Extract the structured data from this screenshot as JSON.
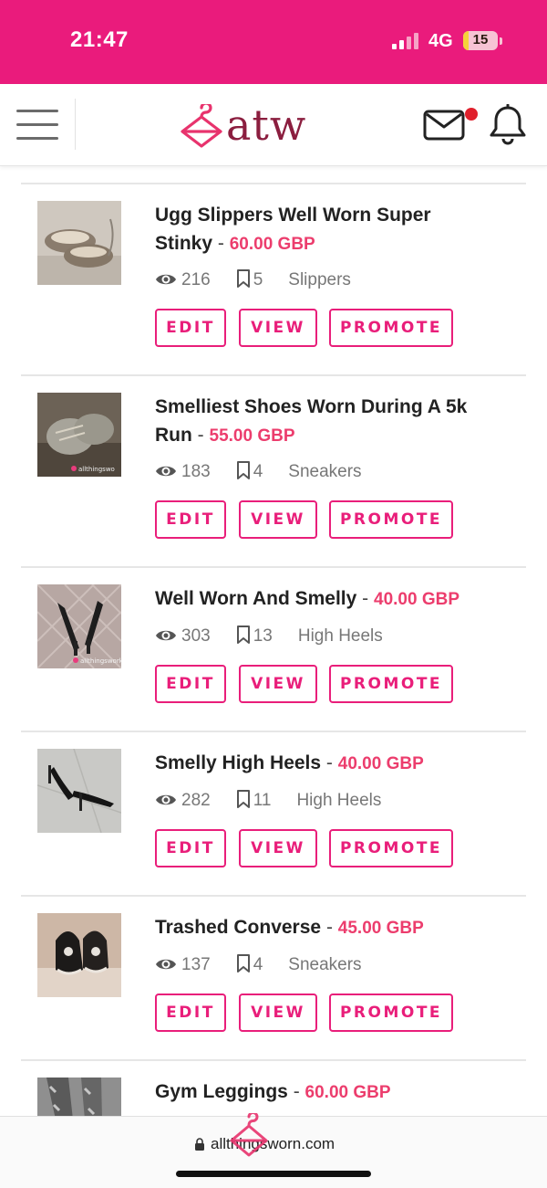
{
  "status_bar": {
    "time": "21:47",
    "network": "4G",
    "battery": "15",
    "battery_level_percent": 15,
    "background": "#ea1b7c"
  },
  "header": {
    "logo_text": "atw",
    "menu_icon": "hamburger-menu-icon",
    "mail_icon": "envelope-icon",
    "bell_icon": "bell-icon",
    "logo_color": "#8b1e3f",
    "accent": "#e91e7a"
  },
  "listings": [
    {
      "title": "Ugg Slippers Well Worn Super Stinky",
      "title_line1": "Ugg Slippers Well Worn Super",
      "title_line2": "Stinky",
      "separator": "-",
      "price": "60.00 GBP",
      "views": "216",
      "saves": "5",
      "category": "Slippers"
    },
    {
      "title": "Smelliest Shoes Worn During A 5k Run",
      "title_line1": "Smelliest Shoes Worn During A 5k",
      "title_line2": "Run",
      "separator": "-",
      "price": "55.00 GBP",
      "views": "183",
      "saves": "4",
      "category": "Sneakers"
    },
    {
      "title": "Well Worn And Smelly",
      "separator": "-",
      "price": "40.00 GBP",
      "views": "303",
      "saves": "13",
      "category": "High Heels"
    },
    {
      "title": "Smelly High Heels",
      "separator": "-",
      "price": "40.00 GBP",
      "views": "282",
      "saves": "11",
      "category": "High Heels"
    },
    {
      "title": "Trashed Converse",
      "separator": "-",
      "price": "45.00 GBP",
      "views": "137",
      "saves": "4",
      "category": "Sneakers"
    },
    {
      "title": "Gym Leggings",
      "separator": "-",
      "price": "60.00 GBP"
    }
  ],
  "buttons": {
    "edit": "EDIT",
    "view": "VIEW",
    "promote": "PROMOTE"
  },
  "url_bar": {
    "url": "allthingsworn.com",
    "lock_icon": "lock-icon"
  },
  "colors": {
    "price": "#ec3d6d",
    "button": "#e91e7a"
  }
}
